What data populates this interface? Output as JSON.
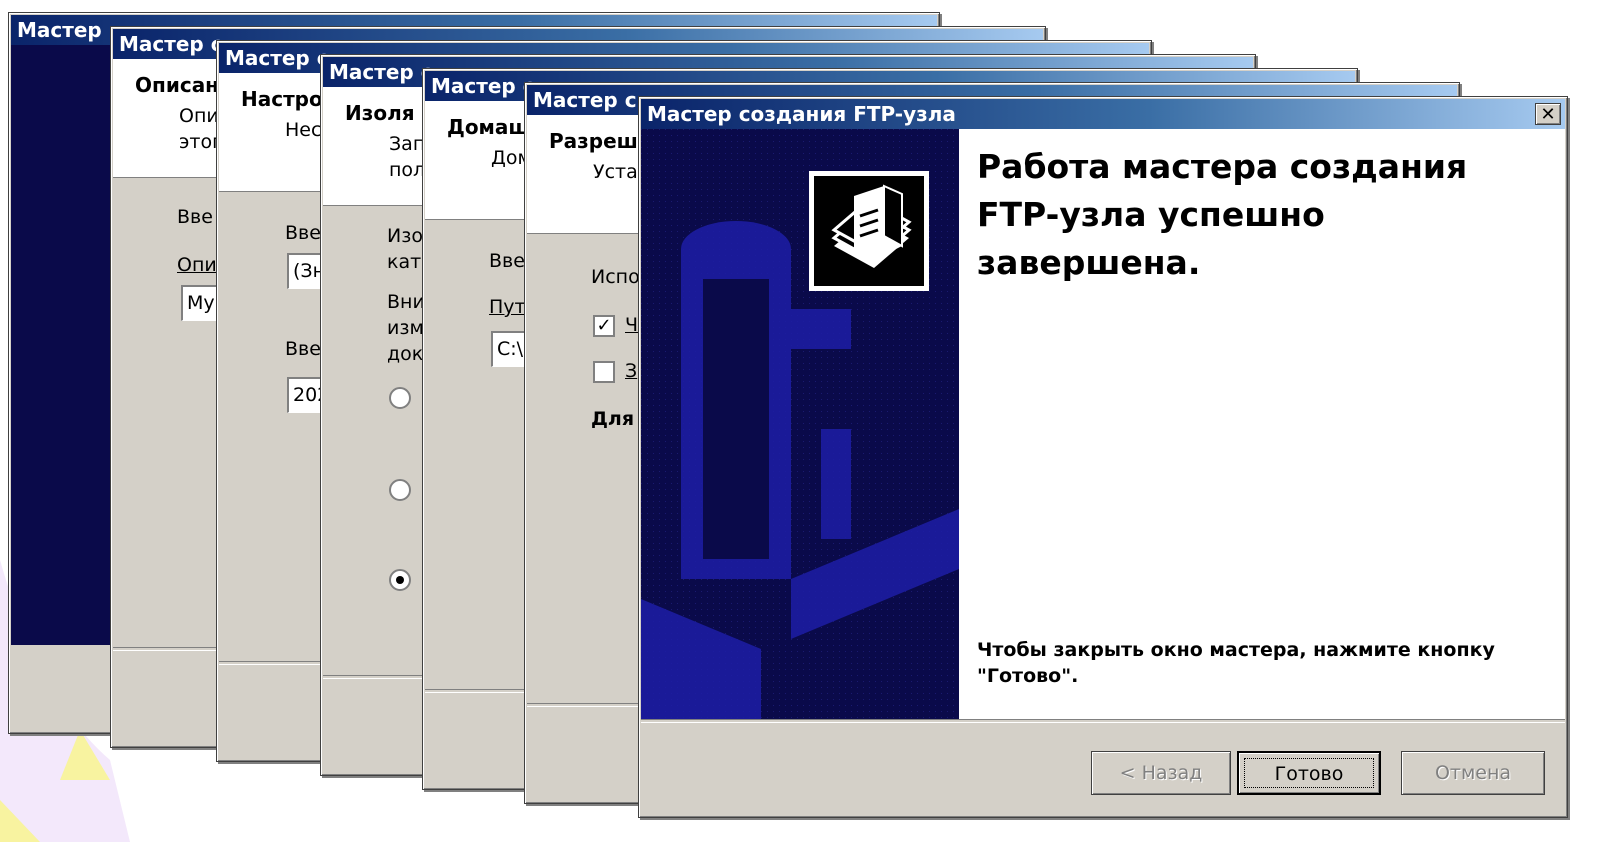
{
  "window_title_stub": "Мастер",
  "stacked_windows": [
    {
      "title": "Мастер с",
      "header_title": "Описан",
      "header_sub": "Опи\nэтог",
      "lines": [
        "Вве",
        "Опи"
      ],
      "field": "Му"
    },
    {
      "title": "Мастер с",
      "header_title": "Настро",
      "header_sub": "Нес",
      "lines": [
        "Вве",
        "Вве"
      ],
      "fields": [
        "(Зн",
        "202"
      ]
    },
    {
      "title": "Мастер с",
      "header_title": "Изоля",
      "header_sub": "Зап\nпол",
      "lines": [
        "Изо\nкат",
        "Вни\nизм\nдок"
      ]
    },
    {
      "title": "Мастер с",
      "header_title": "Домаш",
      "header_sub": "Дом",
      "lines": [
        "Вве",
        "Пут"
      ],
      "field": "C:\\"
    },
    {
      "title": "Мастер с",
      "header_title": "Разреш",
      "header_sub": "Уста",
      "lines": [
        "Испо",
        "Для"
      ],
      "check_labels": [
        "Ч",
        "З"
      ]
    }
  ],
  "front": {
    "title": "Мастер создания FTP-узла",
    "close_glyph": "✕",
    "heading": "Работа мастера создания FTP-узла успешно завершена.",
    "note": "Чтобы закрыть окно мастера, нажмите кнопку \"Готово\".",
    "buttons": {
      "back": "< Назад",
      "finish": "Готово",
      "cancel": "Отмена"
    }
  },
  "colors": {
    "title_bar_start": "#0a246a",
    "sidebar": "#0a0a4a",
    "dialog_face": "#d4d0c8"
  }
}
